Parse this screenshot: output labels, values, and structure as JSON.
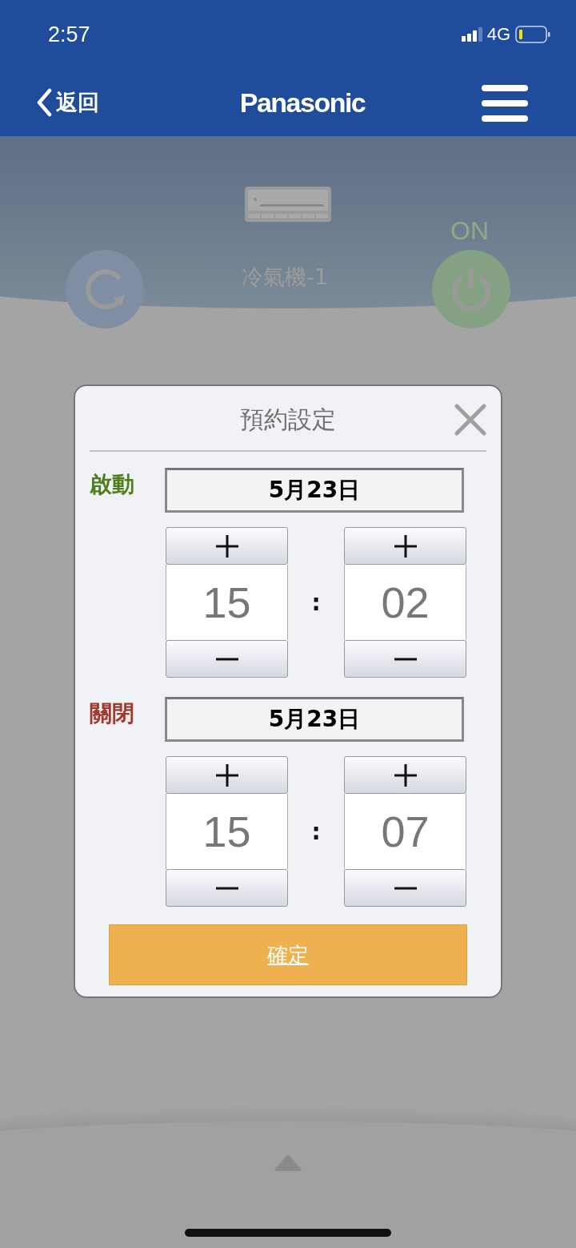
{
  "status_bar": {
    "time": "2:57",
    "network": "4G"
  },
  "header": {
    "back_label": "返回",
    "brand": "Panasonic"
  },
  "device": {
    "name": "冷氣機-1",
    "power_label": "ON"
  },
  "dialog": {
    "title": "預約設定",
    "sections": [
      {
        "kind": "start",
        "label": "啟動",
        "date": "5月23日",
        "hour": "15",
        "separator": ":",
        "minute": "02"
      },
      {
        "kind": "stop",
        "label": "關閉",
        "date": "5月23日",
        "hour": "15",
        "separator": ":",
        "minute": "07"
      }
    ],
    "confirm": "確定"
  }
}
